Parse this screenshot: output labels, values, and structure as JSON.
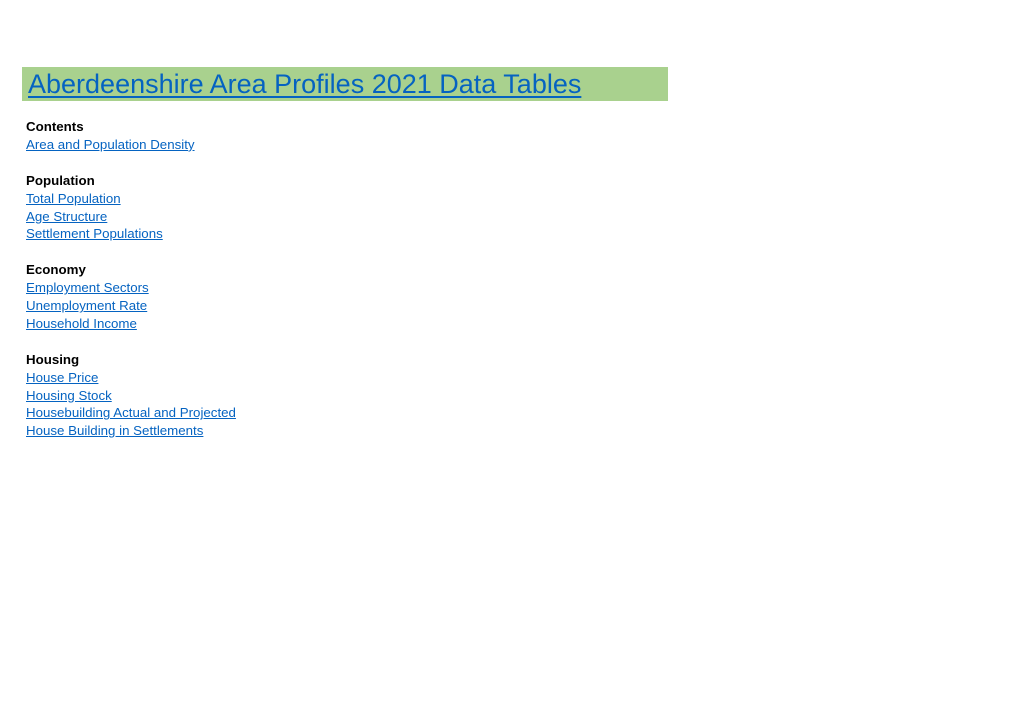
{
  "title": "Aberdeenshire Area Profiles 2021 Data Tables",
  "colors": {
    "banner": "#a9d18e",
    "link": "#0563c1"
  },
  "sections": [
    {
      "heading": "Contents",
      "links": [
        "Area and Population Density"
      ]
    },
    {
      "heading": "Population",
      "links": [
        "Total Population",
        "Age Structure",
        "Settlement Populations"
      ]
    },
    {
      "heading": "Economy",
      "links": [
        "Employment Sectors",
        "Unemployment Rate",
        "Household Income"
      ]
    },
    {
      "heading": "Housing",
      "links": [
        "House Price",
        "Housing Stock",
        "Housebuilding Actual and Projected",
        "House Building in Settlements"
      ]
    }
  ]
}
